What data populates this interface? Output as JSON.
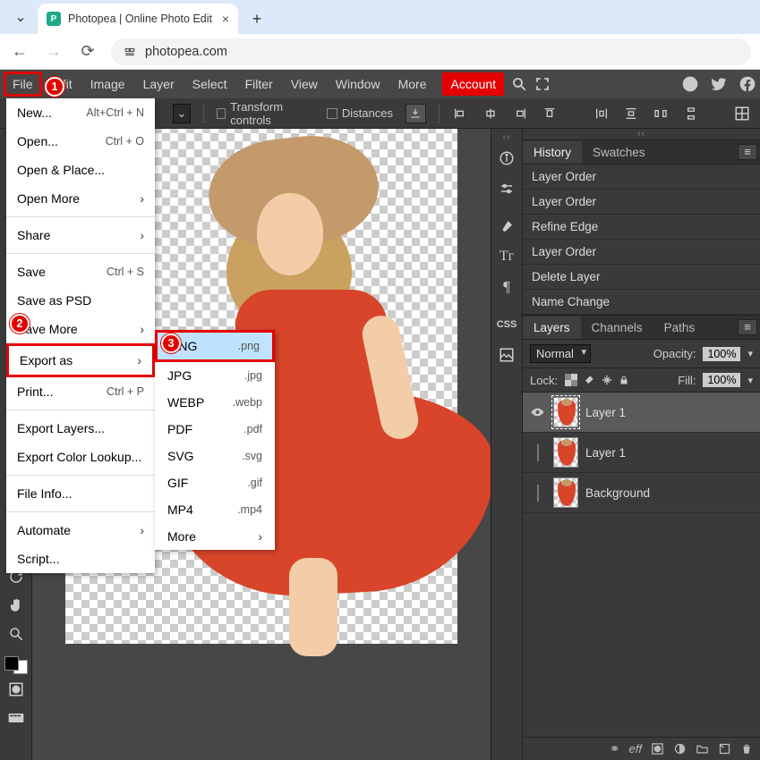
{
  "browser": {
    "tab_title": "Photopea | Online Photo Edit",
    "favicon_letter": "P",
    "url": "photopea.com"
  },
  "menubar": {
    "items": [
      "File",
      "Edit",
      "Image",
      "Layer",
      "Select",
      "Filter",
      "View",
      "Window",
      "More"
    ],
    "account": "Account"
  },
  "options_bar": {
    "transform_controls": "Transform controls",
    "distances": "Distances"
  },
  "file_menu": {
    "items": [
      {
        "label": "New...",
        "shortcut": "Alt+Ctrl + N"
      },
      {
        "label": "Open...",
        "shortcut": "Ctrl + O"
      },
      {
        "label": "Open & Place..."
      },
      {
        "label": "Open More",
        "submenu": true
      },
      {
        "sep": true
      },
      {
        "label": "Share",
        "submenu": true
      },
      {
        "sep": true
      },
      {
        "label": "Save",
        "shortcut": "Ctrl + S"
      },
      {
        "label": "Save as PSD"
      },
      {
        "label": "Save More",
        "submenu": true
      },
      {
        "label": "Export as",
        "submenu": true,
        "highlight": true
      },
      {
        "label": "Print...",
        "shortcut": "Ctrl + P"
      },
      {
        "sep": true
      },
      {
        "label": "Export Layers..."
      },
      {
        "label": "Export Color Lookup..."
      },
      {
        "sep": true
      },
      {
        "label": "File Info..."
      },
      {
        "sep": true
      },
      {
        "label": "Automate",
        "submenu": true
      },
      {
        "label": "Script..."
      }
    ]
  },
  "export_menu": {
    "items": [
      {
        "label": "PNG",
        "ext": ".png",
        "selected": true,
        "highlight": true
      },
      {
        "label": "JPG",
        "ext": ".jpg"
      },
      {
        "label": "WEBP",
        "ext": ".webp"
      },
      {
        "label": "PDF",
        "ext": ".pdf"
      },
      {
        "label": "SVG",
        "ext": ".svg"
      },
      {
        "label": "GIF",
        "ext": ".gif"
      },
      {
        "label": "MP4",
        "ext": ".mp4"
      },
      {
        "label": "More",
        "submenu": true
      }
    ]
  },
  "badges": {
    "one": "1",
    "two": "2",
    "three": "3"
  },
  "history_panel": {
    "tabs": [
      "History",
      "Swatches"
    ],
    "active_tab": 0,
    "items": [
      "Layer Order",
      "Layer Order",
      "Refine Edge",
      "Layer Order",
      "Delete Layer",
      "Name Change"
    ]
  },
  "layers_panel": {
    "tabs": [
      "Layers",
      "Channels",
      "Paths"
    ],
    "active_tab": 0,
    "blend_mode": "Normal",
    "opacity_label": "Opacity:",
    "opacity_value": "100%",
    "lock_label": "Lock:",
    "fill_label": "Fill:",
    "fill_value": "100%",
    "layers": [
      {
        "name": "Layer 1",
        "visible": true,
        "active": true,
        "selected_thumb": true
      },
      {
        "name": "Layer 1",
        "visible": false,
        "active": false
      },
      {
        "name": "Background",
        "visible": false,
        "active": false
      }
    ],
    "footer_eff": "eff"
  }
}
